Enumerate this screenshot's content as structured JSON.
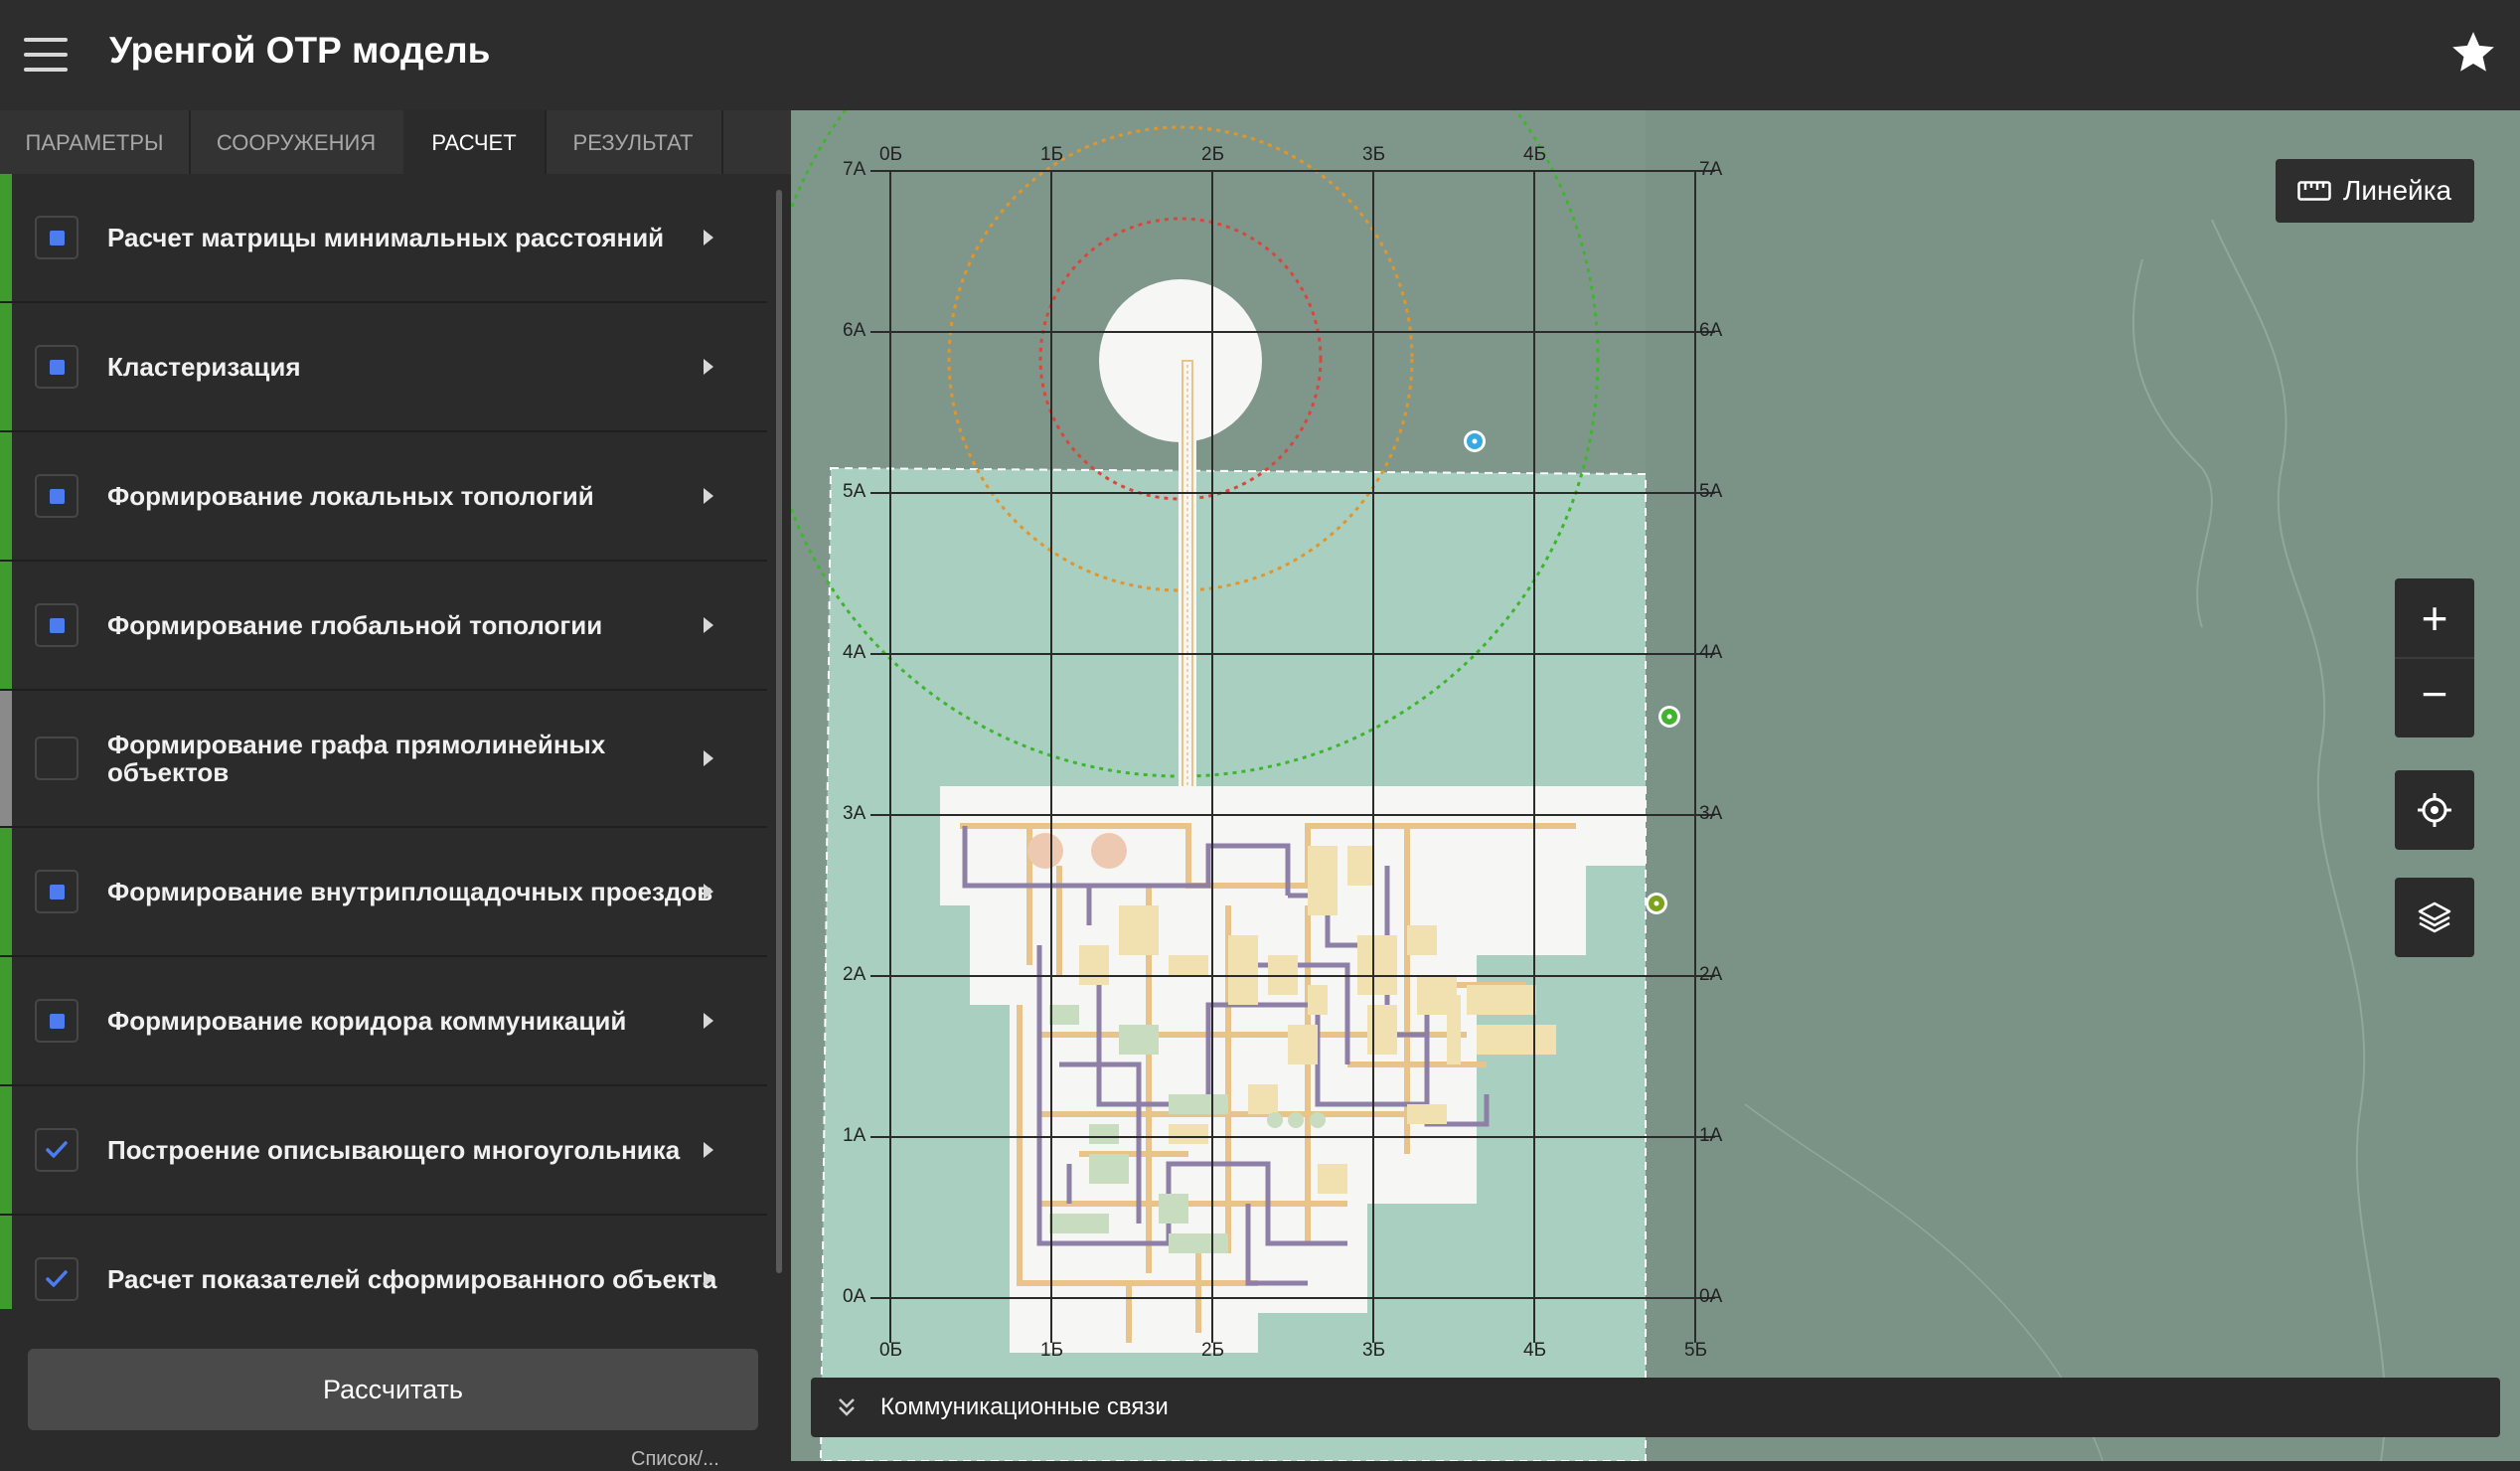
{
  "app": {
    "title": "Уренгой ОТР модель"
  },
  "tabs": [
    {
      "label": "ПАРАМЕТРЫ",
      "active": false
    },
    {
      "label": "СООРУЖЕНИЯ",
      "active": false
    },
    {
      "label": "РАСЧЕТ",
      "active": true
    },
    {
      "label": "РЕЗУЛЬТАТ",
      "active": false
    }
  ],
  "steps": [
    {
      "label": "Расчет матрицы минимальных расстояний",
      "state": "running"
    },
    {
      "label": "Кластеризация",
      "state": "running"
    },
    {
      "label": "Формирование локальных топологий",
      "state": "running"
    },
    {
      "label": "Формирование глобальной топологии",
      "state": "running"
    },
    {
      "label": "Формирование графа прямолинейных объектов",
      "state": "pending"
    },
    {
      "label": "Формирование внутриплощадочных проездов",
      "state": "running"
    },
    {
      "label": "Формирование коридора коммуникаций",
      "state": "running"
    },
    {
      "label": "Построение описывающего многоугольника",
      "state": "done"
    },
    {
      "label": "Расчет показателей сформированного объекта",
      "state": "done"
    }
  ],
  "calculate_button": "Рассчитать",
  "sidebar_peek_text": "Список/...",
  "map": {
    "ruler_label": "Линейка",
    "zoom_in": "+",
    "zoom_out": "−",
    "bottom_panel_label": "Коммуникационные связи",
    "grid_rows": [
      "7А",
      "6А",
      "5А",
      "4А",
      "3А",
      "2А",
      "1А",
      "0А"
    ],
    "grid_cols": [
      "0Б",
      "1Б",
      "2Б",
      "3Б",
      "4Б",
      "5Б"
    ],
    "colors": {
      "background": "#7f978b",
      "site_area": "#a9cfc1",
      "green_ring": "#3fb52e",
      "orange_ring": "#e0962a",
      "red_ring": "#d9473b",
      "road": "#e8c48a",
      "pipe": "#8e7fa6"
    },
    "icons": [
      "ruler-icon",
      "plus-icon",
      "minus-icon",
      "locate-icon",
      "layers-icon",
      "double-chevron-down-icon"
    ]
  }
}
